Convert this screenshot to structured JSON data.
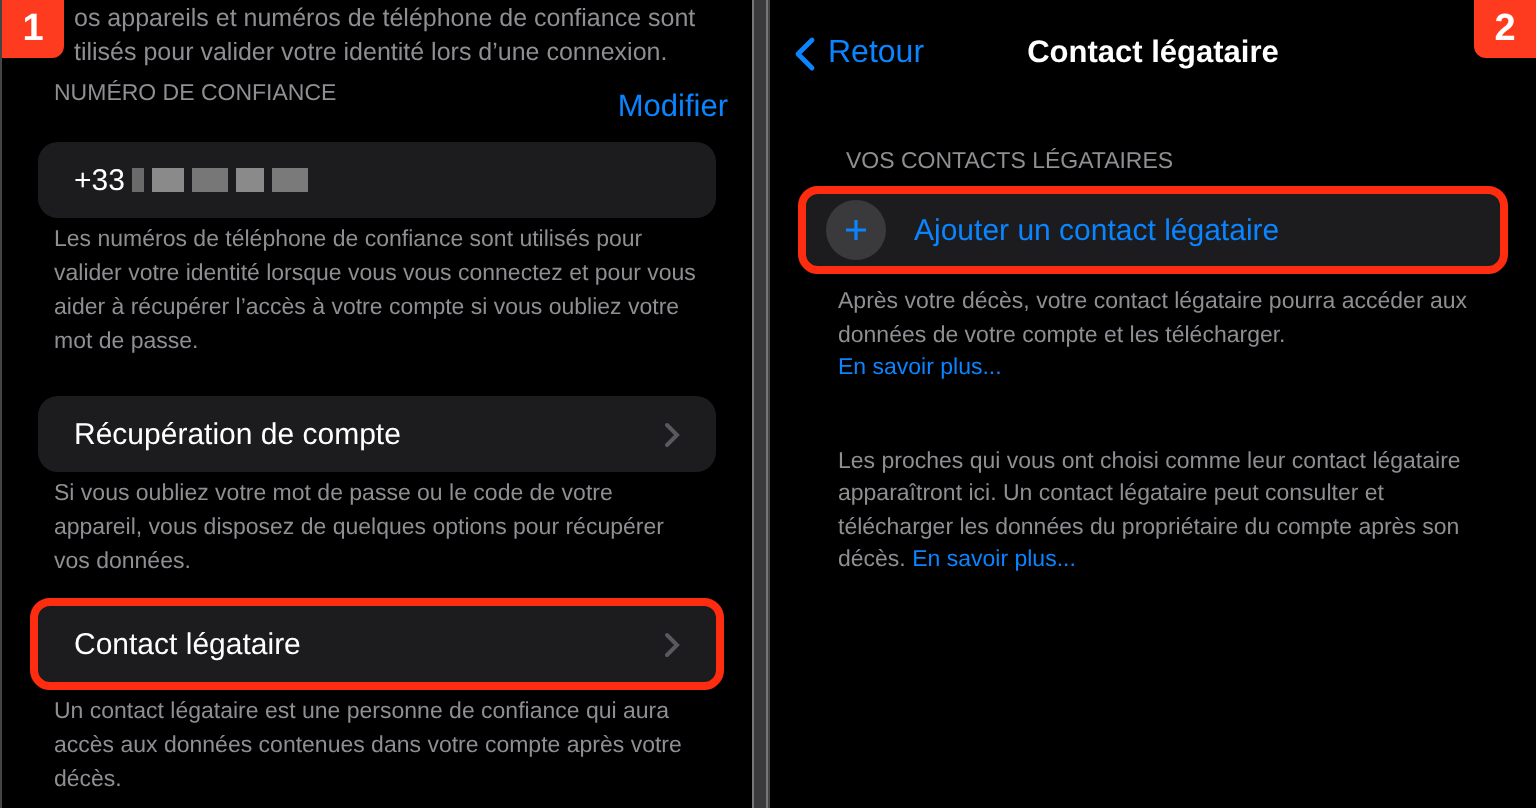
{
  "panels": [
    {
      "badge": "1",
      "intro_lines": [
        "os appareils et numéros de téléphone de confiance sont",
        "tilisés pour valider votre identité lors d’une connexion."
      ],
      "section": {
        "header": "NUMÉRO DE CONFIANCE",
        "action": "Modifier",
        "phone_prefix": "+33",
        "phone_redacted": true,
        "note": "Les numéros de téléphone de confiance sont utilisés pour valider votre identité lorsque vous vous connectez et pour vous aider à récupérer l’accès à votre compte si vous oubliez votre mot de passe."
      },
      "rows": [
        {
          "label": "Récupération de compte",
          "highlighted": false,
          "note": "Si vous oubliez votre mot de passe ou le code de votre appareil, vous disposez de quelques options pour récupérer vos données."
        },
        {
          "label": "Contact légataire",
          "highlighted": true,
          "note": "Un contact légataire est une personne de confiance qui aura accès aux données contenues dans votre compte après votre décès."
        }
      ]
    },
    {
      "badge": "2",
      "back": "Retour",
      "title": "Contact légataire",
      "header": "VOS CONTACTS LÉGATAIRES",
      "add_row": {
        "label": "Ajouter un contact légataire",
        "highlighted": true
      },
      "note1": {
        "text": "Après votre décès, votre contact légataire pourra accéder aux données de votre compte et les télécharger.",
        "link": "En savoir plus..."
      },
      "note2": {
        "text": "Les proches qui vous ont choisi comme leur contact légataire apparaîtront ici. Un contact légataire peut consulter et télécharger les données du propriétaire du compte après son décès.",
        "link": "En savoir plus..."
      }
    }
  ]
}
